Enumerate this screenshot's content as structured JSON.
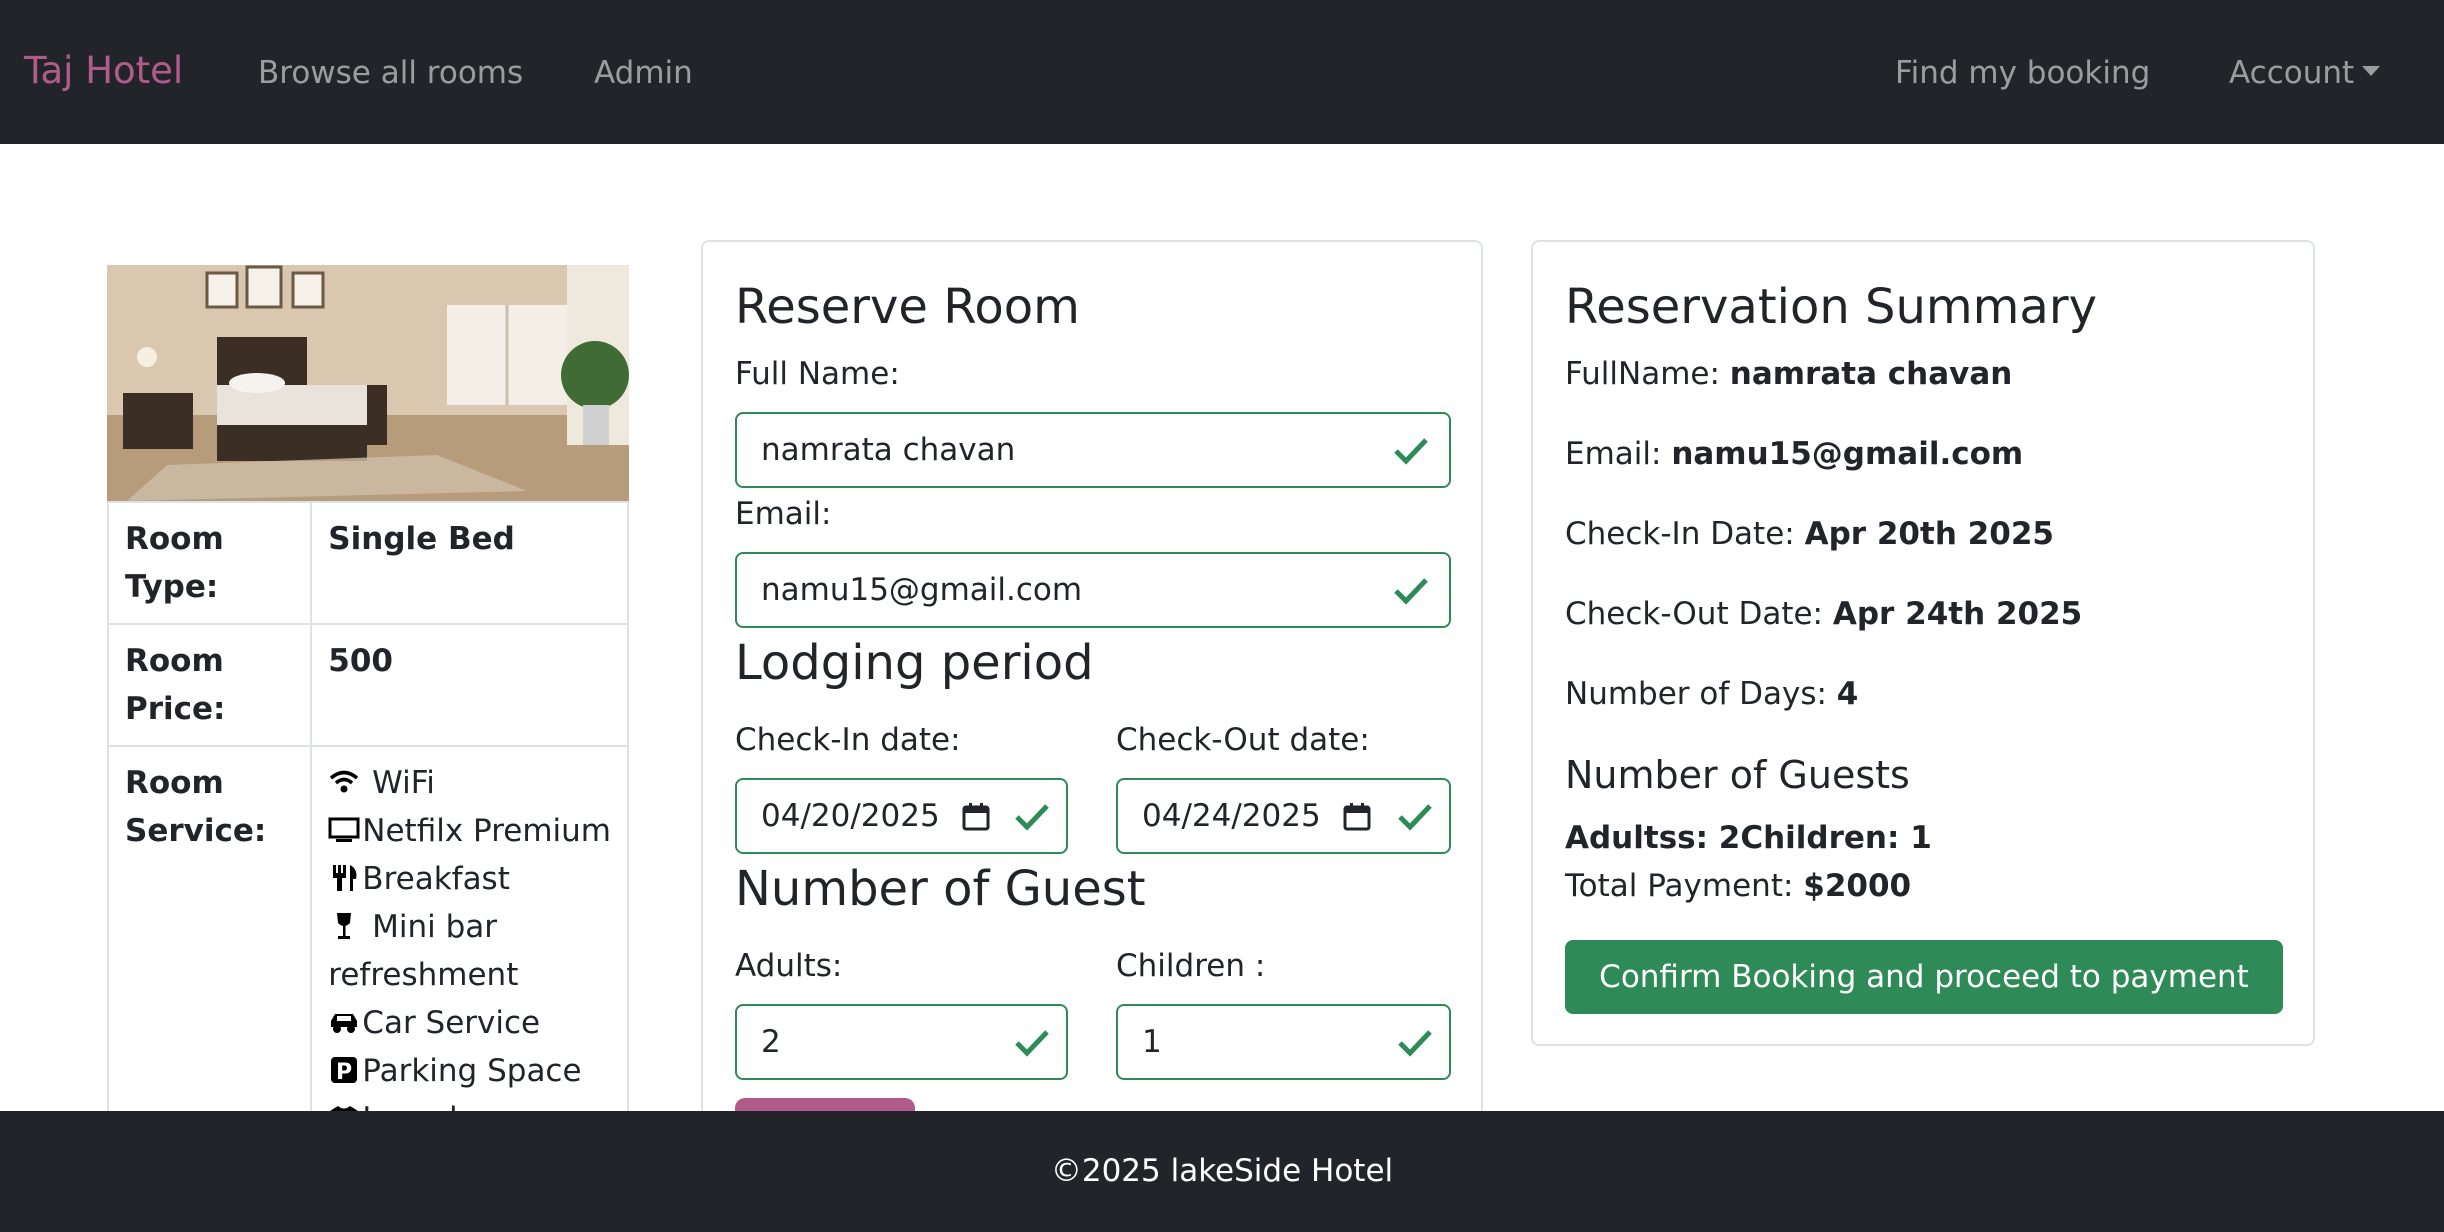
{
  "nav": {
    "brand": "Taj Hotel",
    "browse": "Browse all rooms",
    "admin": "Admin",
    "find_booking": "Find my booking",
    "account": "Account"
  },
  "room": {
    "type_label": "Room Type:",
    "type_value": "Single Bed",
    "price_label_1": "Room",
    "price_label_2": "Price:",
    "price_value": "500",
    "service_label_1": "Room",
    "service_label_2": "Service:",
    "services": [
      {
        "icon": "wifi-icon",
        "label": " WiFi"
      },
      {
        "icon": "tv-icon",
        "label": "Netfilx Premium"
      },
      {
        "icon": "utensils-icon",
        "label": "Breakfast"
      },
      {
        "icon": "wine-glass-icon",
        "label": " Mini bar refreshment"
      },
      {
        "icon": "car-icon",
        "label": "Car Service"
      },
      {
        "icon": "parking-icon",
        "label": "Parking Space"
      },
      {
        "icon": "tshirt-icon",
        "label": "Laundry"
      }
    ]
  },
  "reserve": {
    "title": "Reserve Room",
    "full_name_label": "Full Name:",
    "full_name_value": "namrata chavan",
    "email_label": "Email:",
    "email_value": "namu15@gmail.com",
    "lodging_title": "Lodging period",
    "checkin_label": "Check-In date:",
    "checkin_value": "04/20/2025",
    "checkout_label": "Check-Out date:",
    "checkout_value": "04/24/2025",
    "guest_title": "Number of Guest",
    "adults_label": "Adults:",
    "adults_value": "2",
    "children_label": "Children :",
    "children_value": "1"
  },
  "summary": {
    "title": "Reservation Summary",
    "fullname_label": "FullName: ",
    "fullname_value": "namrata chavan",
    "email_label": "Email: ",
    "email_value": "namu15@gmail.com",
    "checkin_label": "Check-In Date: ",
    "checkin_value": "Apr 20th 2025",
    "checkout_label": "Check-Out Date: ",
    "checkout_value": "Apr 24th 2025",
    "days_label": "Number of Days: ",
    "days_value": "4",
    "guests_title": "Number of Guests",
    "guests_text": "Adultss: 2Children: 1",
    "total_label": "Total Payment: ",
    "total_value": "$2000",
    "confirm_button": "Confirm Booking and proceed to payment"
  },
  "footer": {
    "text": "©2025 lakeSide Hotel"
  },
  "colors": {
    "navbar_bg": "#212529",
    "brand": "#b05c8a",
    "valid_green": "#2e8b57",
    "secondary_button": "#b05c8a"
  }
}
